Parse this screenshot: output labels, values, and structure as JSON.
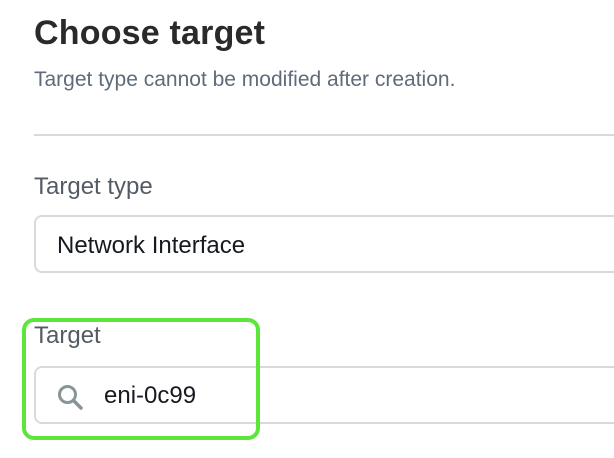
{
  "section": {
    "title": "Choose target",
    "description": "Target type cannot be modified after creation."
  },
  "target_type": {
    "label": "Target type",
    "selected_value": "Network Interface"
  },
  "target": {
    "label": "Target",
    "value": "eni-0c99",
    "icon": "search-icon"
  },
  "colors": {
    "highlight": "#5ce63a",
    "border": "#d5dbdb",
    "label": "#545b64"
  }
}
